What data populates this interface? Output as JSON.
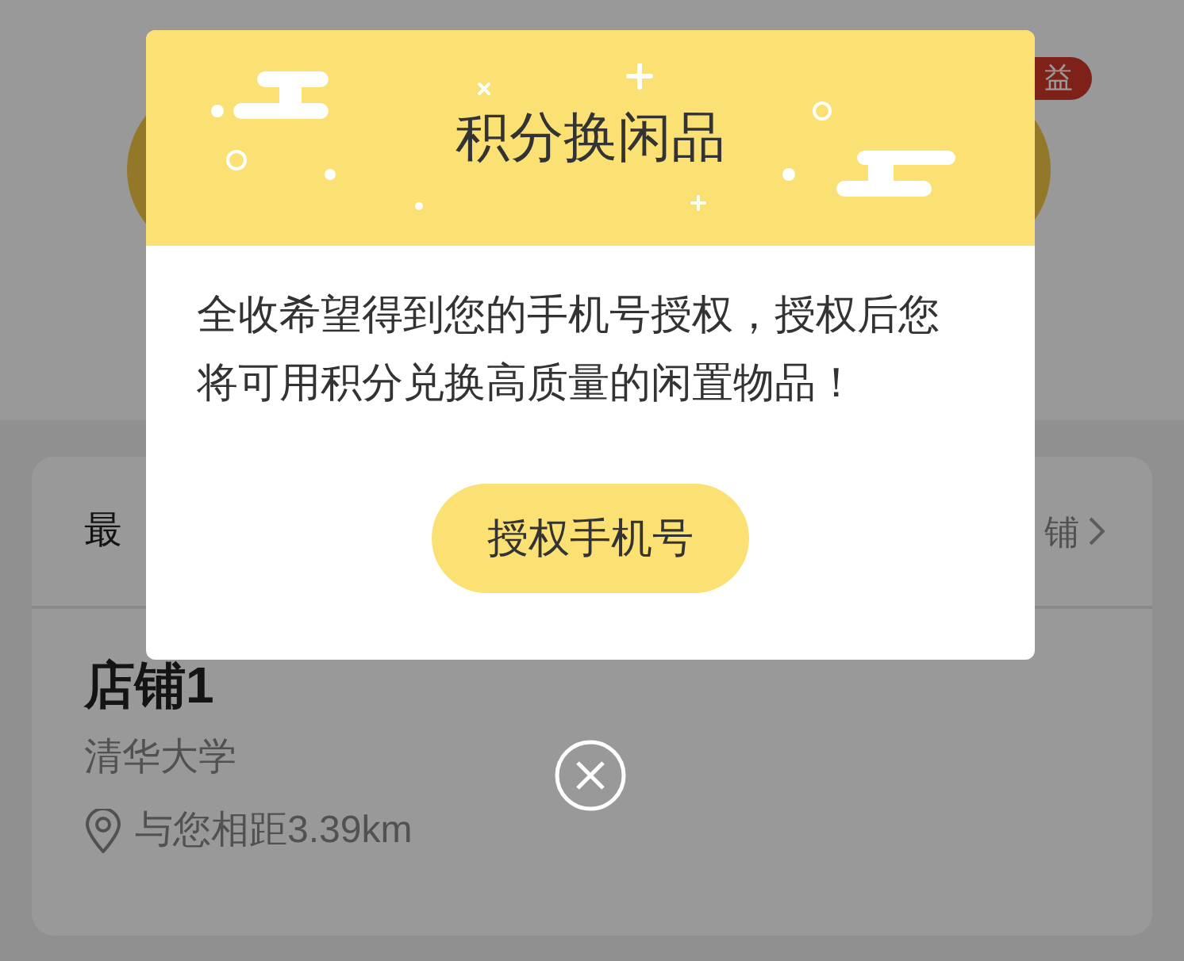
{
  "background": {
    "badge": "益",
    "header_left": "最",
    "header_right": "铺",
    "shop": {
      "name": "店铺1",
      "location": "清华大学",
      "distance": "与您相距3.39km"
    }
  },
  "dialog": {
    "title": "积分换闲品",
    "message": "全收希望得到您的手机号授权，授权后您将可用积分兑换高质量的闲置物品！",
    "button": "授权手机号"
  }
}
